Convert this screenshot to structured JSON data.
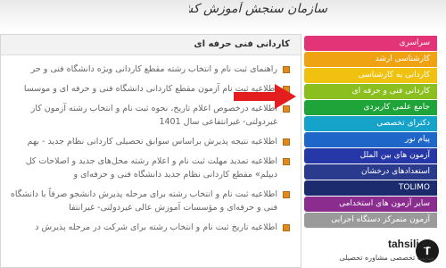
{
  "header": {
    "logo_text": "سازمان سنجش آموزش کشور"
  },
  "content": {
    "title": "کاردانی فنی حرفه ای",
    "news": [
      "راهنمای ثبت نام و انتخاب رشته مقطع کاردانی ویژه دانشگاه فنی و حر",
      "اطلاعیه ثبت نام آزمون مقطع کاردانی دانشگاه فنی و حرفه ای و موسسا",
      "اطلاعیه درخصوص اعلام تاریخ، نحوه ثبت نام و انتخاب رشته آزمون کار غیردولتی- غیرانتفاعی سال 1401",
      "اطلاعیه نتیجه پذیرش براساس سوابق تحصیلی کاردانی نظام جدید - بهم",
      "اطلاعیه تمدید مهلت ثبت نام و اعلام رشته محل‌های جدید و اصلاحات کل دیپلم» مقطع کاردانی نظام جدید دانشگاه فنی و حرفه‌ای و",
      "اطلاعیه ثبت نام و انتخاب رشته برای مرحله پذیرش دانشجو صرفاً با دانشگاه فنی و حرفه‌ای و مؤسسات آموزش عالی غیردولتی- غیرانتفا",
      "اطلاعیه تاریخ ثبت نام و انتخاب رشته برای شرکت در مرحله پذیرش د"
    ]
  },
  "menu": {
    "items": [
      {
        "label": "سراسری",
        "color": "#e43478"
      },
      {
        "label": "کارشناسی ارشد",
        "color": "#f0a312"
      },
      {
        "label": "کاردانی به کارشناسی",
        "color": "#f0c20f"
      },
      {
        "label": "کاردانی فنی و حرفه ای",
        "color": "#8bbf1f"
      },
      {
        "label": "جامع علمی کاربردی",
        "color": "#1fa43a"
      },
      {
        "label": "دکترای تخصصی",
        "color": "#15a3c9"
      },
      {
        "label": "پیام نور",
        "color": "#1f66c9"
      },
      {
        "label": "آزمون های بین الملل",
        "color": "#2637a8"
      },
      {
        "label": "استعدادهای درخشان",
        "color": "#2a3a8c"
      },
      {
        "label": "TOLIMO",
        "color": "#1c2a6e"
      },
      {
        "label": "سایر آزمون های استخدامی",
        "color": "#8b2c8f"
      },
      {
        "label": "آزمون متمرکز دستگاه اجرایی",
        "color": "#9a9a9a"
      }
    ]
  },
  "footer": {
    "brand": "tahsili.co",
    "tagline": "سایت تخصصی مشاوره تحصیلی",
    "mark": "T"
  }
}
